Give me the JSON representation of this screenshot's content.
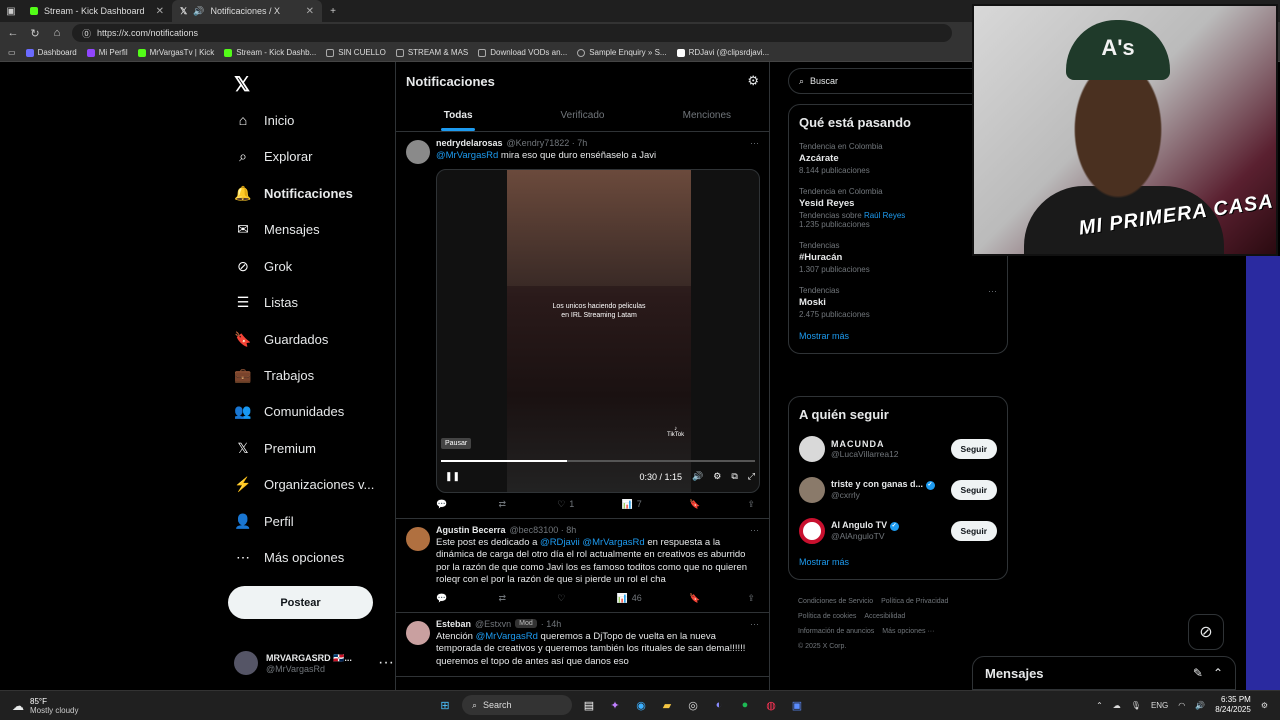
{
  "browser": {
    "tabs": [
      {
        "title": "Stream - Kick Dashboard",
        "color": "#53fc18"
      },
      {
        "title": "Notificaciones / X",
        "color": "#ffffff"
      }
    ],
    "url": "https://x.com/notifications",
    "bookmarks": [
      {
        "label": "Dashboard",
        "color": "#6b6bff"
      },
      {
        "label": "Mi Perfil",
        "color": "#9146ff"
      },
      {
        "label": "MrVargasTv | Kick",
        "color": "#53fc18"
      },
      {
        "label": "Stream - Kick Dashb...",
        "color": "#53fc18"
      },
      {
        "label": "SIN CUELLO",
        "color": "#888888"
      },
      {
        "label": "STREAM & MAS",
        "color": "#888888"
      },
      {
        "label": "Download VODs an...",
        "color": "#888888"
      },
      {
        "label": "Sample Enquiry » S...",
        "color": "#888888"
      },
      {
        "label": "RDJavi (@clipsrdjavi...",
        "color": "#ffffff"
      }
    ]
  },
  "nav": {
    "items": [
      {
        "label": "Inicio",
        "icon": "⌂"
      },
      {
        "label": "Explorar",
        "icon": "⌕"
      },
      {
        "label": "Notificaciones",
        "icon": "🔔"
      },
      {
        "label": "Mensajes",
        "icon": "✉"
      },
      {
        "label": "Grok",
        "icon": "⊘"
      },
      {
        "label": "Listas",
        "icon": "☰"
      },
      {
        "label": "Guardados",
        "icon": "🔖"
      },
      {
        "label": "Trabajos",
        "icon": "💼"
      },
      {
        "label": "Comunidades",
        "icon": "👥"
      },
      {
        "label": "Premium",
        "icon": "𝕏"
      },
      {
        "label": "Organizaciones v...",
        "icon": "⚡"
      },
      {
        "label": "Perfil",
        "icon": "👤"
      },
      {
        "label": "Más opciones",
        "icon": "⋯"
      }
    ],
    "post_label": "Postear",
    "me": {
      "name": "MRVARGASRD 🇩🇴...",
      "handle": "@MrVargasRd"
    }
  },
  "center": {
    "title": "Notificaciones",
    "tabs": [
      "Todas",
      "Verificado",
      "Menciones"
    ],
    "tweets": [
      {
        "name": "nedrydelarosas",
        "handle": "@Kendry71822 · 7h",
        "mention": "@MrVargasRd",
        "text": " mira eso que duro enséñaselo a Javi",
        "video": {
          "caption": "Los unicos haciendo peliculas en IRL Streaming Latam",
          "watermark": "TikTok",
          "pause_tip": "Pausar",
          "time": "0:30 / 1:15",
          "progress": 0.4
        },
        "stats": {
          "reply": "",
          "retweet": "",
          "like": "1",
          "views": "7"
        }
      },
      {
        "name": "Agustin Becerra",
        "handle": "@bec83100 · 8h",
        "pre": "Este post es dedicado a ",
        "mention1": "@RDjavii",
        "mention2": "@MrVargasRd",
        "text": " en respuesta a la dinámica de carga del otro día el rol actualmente en creativos es aburrido por la razón de que como Javi los es famoso toditos como que no quieren roleqr con el por la razón de que si pierde un rol el cha",
        "stats": {
          "reply": "",
          "retweet": "",
          "like": "",
          "views": "46"
        }
      },
      {
        "name": "Esteban",
        "handle": "@Estxvn",
        "badge": "Mod",
        "time": "· 14h",
        "pre": "Atención ",
        "mention": "@MrVargasRd",
        "text": " queremos a DjTopo de vuelta en la nueva temporada de creativos y queremos también los rituales de san dema!!!!!! queremos el topo de antes así que danos eso"
      }
    ]
  },
  "right": {
    "search_placeholder": "Buscar",
    "trends_title": "Qué está pasando",
    "trends": [
      {
        "meta": "Tendencia en Colombia",
        "name": "Azcárate",
        "count": "8.144 publicaciones"
      },
      {
        "meta": "Tendencia en Colombia",
        "name": "Yesid Reyes",
        "sub": "Tendencias sobre",
        "sub_link": "Raúl Reyes",
        "count": "1.235 publicaciones"
      },
      {
        "meta": "Tendencias",
        "name": "#Huracán",
        "count": "1.307 publicaciones"
      },
      {
        "meta": "Tendencias",
        "name": "Moski",
        "count": "2.475 publicaciones"
      }
    ],
    "show_more": "Mostrar más",
    "follow_title": "A quién seguir",
    "follow": [
      {
        "name": "MACUNDA",
        "handle": "@LucaVillarrea12",
        "color": "#d9d9d9"
      },
      {
        "name": "triste y con ganas d...",
        "handle": "@cxrrly",
        "color": "#8a7a6a"
      },
      {
        "name": "Al Angulo TV",
        "handle": "@AlAnguloTV",
        "color": "#c8102e"
      }
    ],
    "follow_label": "Seguir",
    "footer": [
      "Condiciones de Servicio",
      "Política de Privacidad",
      "Política de cookies",
      "Accesibilidad",
      "Información de anuncios",
      "Más opciones ···",
      "© 2025 X Corp."
    ]
  },
  "overlay": {
    "logo_text": "MI PRIMERA CASA",
    "hat_text": "A's"
  },
  "messages_dock": {
    "title": "Mensajes"
  },
  "taskbar": {
    "temp": "85°F",
    "weather": "Mostly cloudy",
    "search": "Search",
    "lang": "ENG",
    "time": "6:35 PM",
    "date": "8/24/2025"
  }
}
